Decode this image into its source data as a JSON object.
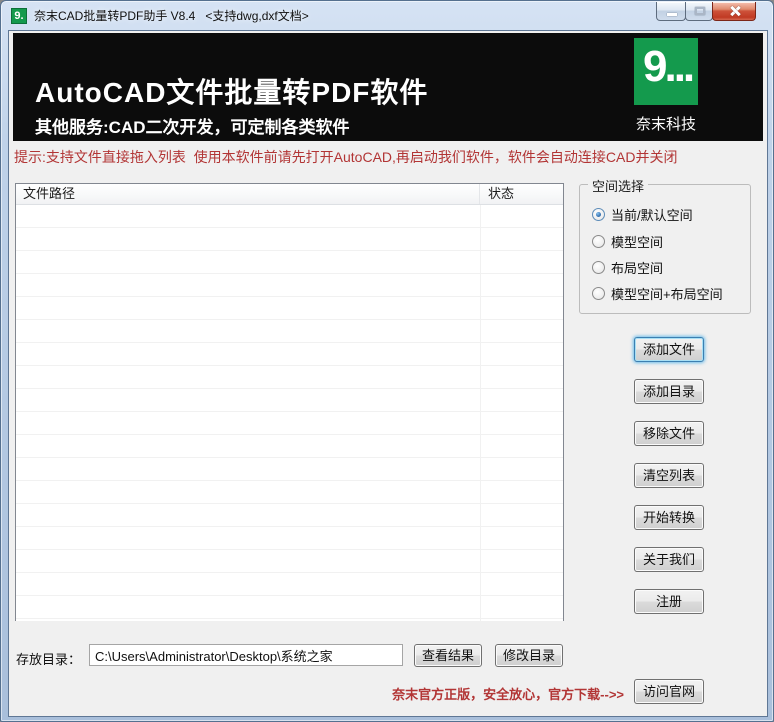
{
  "window": {
    "title": "奈末CAD批量转PDF助手 V8.4   <支持dwg,dxf文档>",
    "app_icon_text": "9."
  },
  "banner": {
    "title": "AutoCAD文件批量转PDF软件",
    "subtitle": "其他服务:CAD二次开发，可定制各类软件",
    "logo_text": "9...",
    "brand": "奈末科技"
  },
  "tip": "提示:支持文件直接拖入列表  使用本软件前请先打开AutoCAD,再启动我们软件，软件会自动连接CAD并关闭",
  "file_list": {
    "columns": [
      "文件路径",
      "状态"
    ],
    "rows": []
  },
  "space_group": {
    "title": "空间选择",
    "options": [
      {
        "label": "当前/默认空间",
        "selected": true
      },
      {
        "label": "模型空间",
        "selected": false
      },
      {
        "label": "布局空间",
        "selected": false
      },
      {
        "label": "模型空间+布局空间",
        "selected": false
      }
    ]
  },
  "buttons": {
    "add_file": "添加文件",
    "add_dir": "添加目录",
    "remove_file": "移除文件",
    "clear_list": "清空列表",
    "start_convert": "开始转换",
    "about_us": "关于我们",
    "register": "注册",
    "view_result": "查看结果",
    "modify_dir": "修改目录",
    "visit_site": "访问官网"
  },
  "output": {
    "label": "存放目录：",
    "path": "C:\\Users\\Administrator\\Desktop\\系统之家"
  },
  "footer_promo": "奈末官方正版，安全放心，官方下载-->>",
  "colors": {
    "accent_green": "#149a4d",
    "tip_red": "#b23535",
    "banner_bg": "#0c0c0c",
    "frame_blue": "#b3c8e2"
  }
}
